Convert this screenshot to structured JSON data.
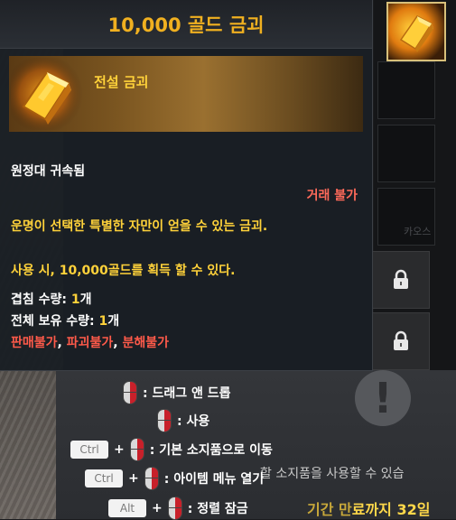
{
  "tooltip": {
    "title": "10,000 골드 금괴",
    "grade": "전설 금괴",
    "bound": "원정대 귀속됨",
    "trade": "거래 불가",
    "description": "운명이 선택한 특별한 자만이 얻을 수 있는 금괴.",
    "usage": "사용 시, 10,000골드를 획득 할 수 있다.",
    "stack_label": "겹침 수량: ",
    "stack_value": "1",
    "stack_unit": "개",
    "owned_label": "전체 보유 수량: ",
    "owned_value": "1",
    "owned_unit": "개",
    "restrictions": [
      "판매불가",
      "파괴불가",
      "분해불가"
    ],
    "restriction_separator": ", ",
    "icon": "gold-bar-icon"
  },
  "hints": [
    {
      "keys": [],
      "mouse": "right-click",
      "label": ": 드래그 앤 드롭"
    },
    {
      "keys": [],
      "mouse": "right-click",
      "label": ": 사용"
    },
    {
      "keys": [
        "Ctrl"
      ],
      "mouse": "right-click",
      "label": ": 기본 소지품으로 이동"
    },
    {
      "keys": [
        "Ctrl"
      ],
      "mouse": "right-click",
      "label": ": 아이템 메뉴 열기"
    },
    {
      "keys": [
        "Alt"
      ],
      "mouse": "right-click",
      "label": ": 정렬 잠금"
    }
  ],
  "background": {
    "panel_notice": "할 소지품을 사용할 수 있습",
    "faint_label": "카오스",
    "expiry_prefix": "기간 만",
    "expiry_main": "료까지 32일"
  },
  "colors": {
    "title_gold": "#f0b020",
    "highlight_yellow": "#ffd23a",
    "warning_red": "#ff5a4a"
  }
}
